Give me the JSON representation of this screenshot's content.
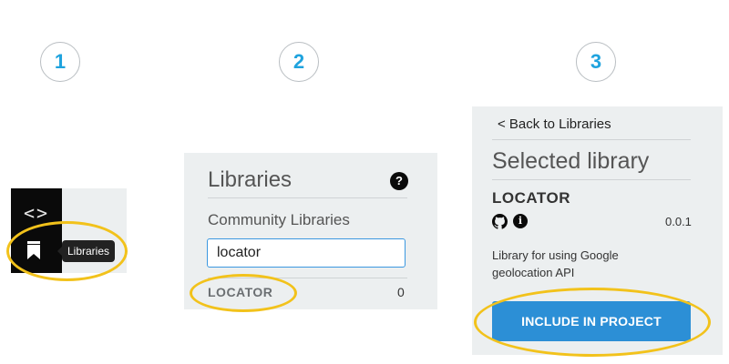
{
  "steps": [
    {
      "number": "1"
    },
    {
      "number": "2"
    },
    {
      "number": "3"
    }
  ],
  "colors": {
    "accent_blue": "#1fa3de",
    "highlight_yellow": "#f2c21b",
    "button_blue": "#2c8fd6",
    "panel_gray": "#eceff0"
  },
  "panel1": {
    "code_icon": "code-icon",
    "libraries_icon": "bookmark-icon",
    "tooltip": "Libraries"
  },
  "panel2": {
    "title": "Libraries",
    "help_icon": "question-icon",
    "help_glyph": "?",
    "subheading": "Community Libraries",
    "search_value": "locator",
    "result_name": "LOCATOR",
    "result_count": "0"
  },
  "panel3": {
    "back_link": "< Back to Libraries",
    "title": "Selected library",
    "library_name": "LOCATOR",
    "github_icon": "github-icon",
    "info_icon": "info-icon",
    "info_glyph": "i",
    "version": "0.0.1",
    "description": "Library for using Google geolocation API",
    "include_button": "INCLUDE IN PROJECT"
  }
}
